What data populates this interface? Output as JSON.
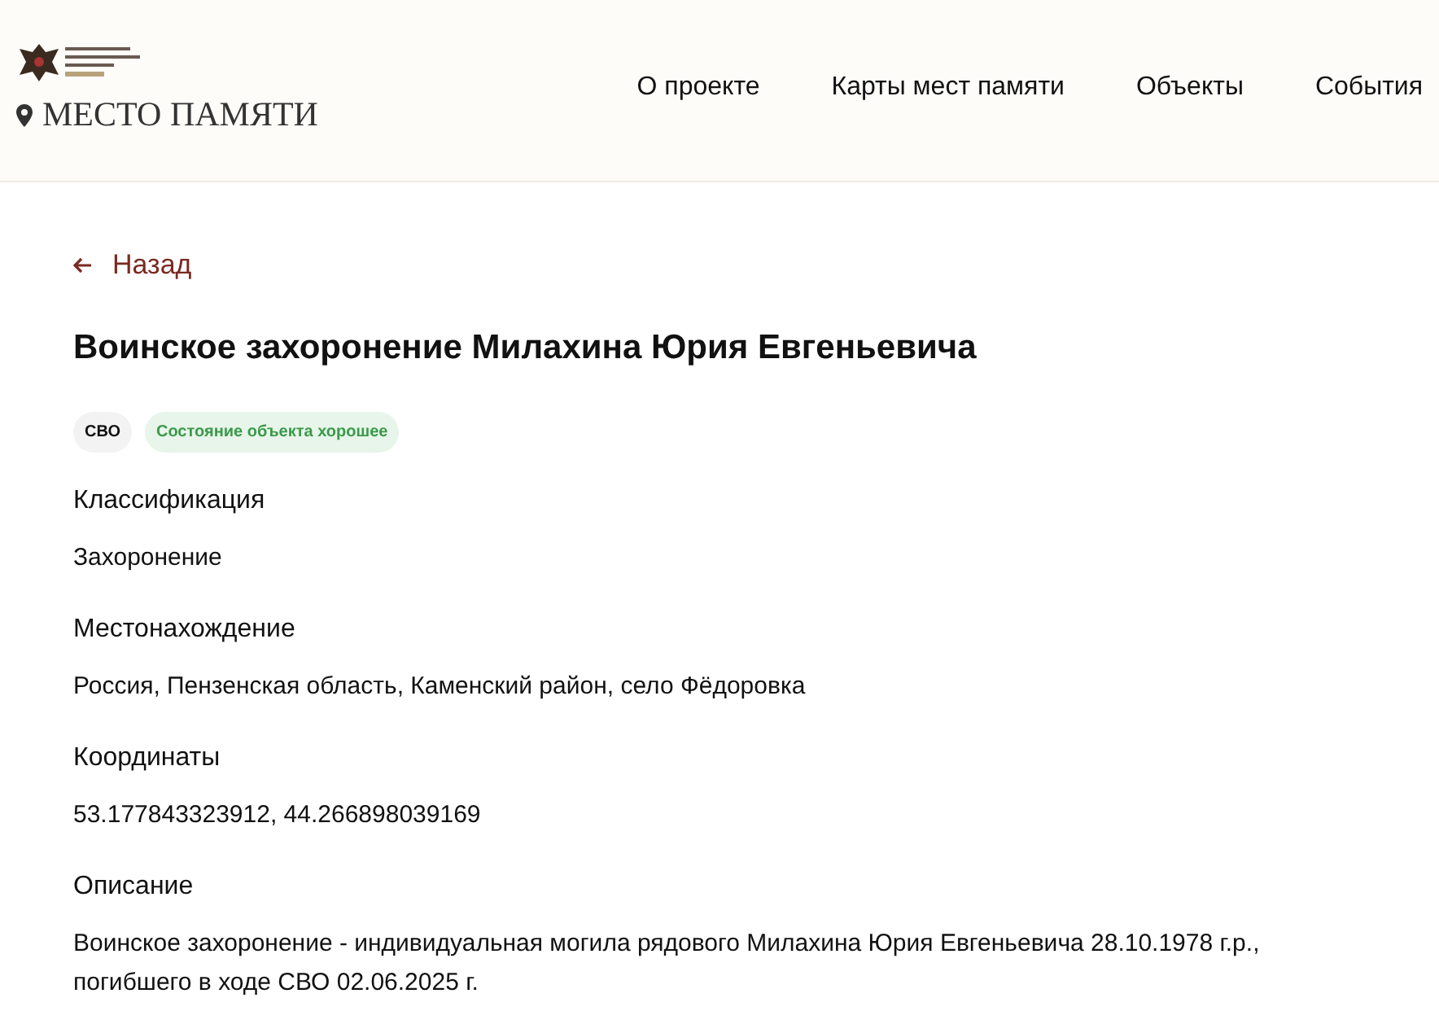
{
  "header": {
    "site_name": "МЕСТО ПАМЯТИ",
    "nav": [
      {
        "label": "О проекте"
      },
      {
        "label": "Карты мест памяти"
      },
      {
        "label": "Объекты"
      },
      {
        "label": "События"
      }
    ]
  },
  "back_link": "Назад",
  "title": "Воинское захоронение Милахина Юрия Евгеньевича",
  "tags": [
    {
      "label": "СВО",
      "kind": "neutral"
    },
    {
      "label": "Состояние объекта хорошее",
      "kind": "success"
    }
  ],
  "fields": [
    {
      "label": "Классификация",
      "value": "Захоронение"
    },
    {
      "label": "Местонахождение",
      "value": "Россия, Пензенская область, Каменский район, село Фёдоровка"
    },
    {
      "label": "Координаты",
      "value": "53.177843323912, 44.266898039169"
    },
    {
      "label": "Описание",
      "value": "Воинское захоронение - индивидуальная могила рядового Милахина Юрия Евгеньевича 28.10.1978 г.р., погибшего в ходе СВО 02.06.2025 г."
    }
  ]
}
